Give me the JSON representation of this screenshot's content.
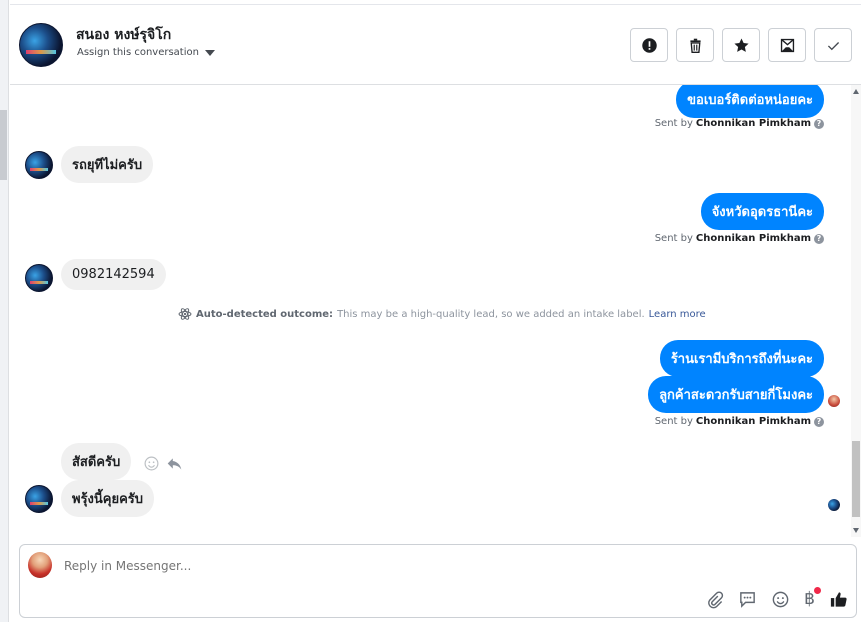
{
  "header": {
    "contact_name": "สนอง หงษ์รุจิโก",
    "assign_label": "Assign this conversation",
    "actions": [
      {
        "icon": "exclamation-icon",
        "label": "Mark as spam"
      },
      {
        "icon": "trash-icon",
        "label": "Delete"
      },
      {
        "icon": "star-icon",
        "label": "Star"
      },
      {
        "icon": "mail-icon",
        "label": "Mark as unread"
      },
      {
        "icon": "check-icon",
        "label": "Mark as done"
      }
    ]
  },
  "messages": [
    {
      "side": "out",
      "text": "ขอเบอร์ติดต่อหน่อยคะ"
    },
    {
      "side": "meta",
      "sent_by_prefix": "Sent by",
      "sent_by_name": "Chonnikan Pimkham"
    },
    {
      "side": "in",
      "text": "รถยุทีไม่ครับ"
    },
    {
      "side": "out",
      "text": "จังหวัดอุดรธานีคะ"
    },
    {
      "side": "meta",
      "sent_by_prefix": "Sent by",
      "sent_by_name": "Chonnikan Pimkham"
    },
    {
      "side": "in",
      "text": "0982142594"
    },
    {
      "side": "out",
      "text": "ร้านเรามีบริการถึงที่นะคะ"
    },
    {
      "side": "out",
      "text": "ลูกค้าสะดวกรับสายกี่โมงคะ"
    },
    {
      "side": "meta",
      "sent_by_prefix": "Sent by",
      "sent_by_name": "Chonnikan Pimkham"
    },
    {
      "side": "in",
      "text": "สัสดีครับ"
    },
    {
      "side": "in",
      "text": "พรุ้งนี้คุยครับ"
    }
  ],
  "auto_detect": {
    "title": "Auto-detected outcome:",
    "text": "This may be a high-quality lead, so we added an intake label.",
    "link": "Learn more"
  },
  "composer": {
    "placeholder": "Reply in Messenger...",
    "tools": [
      "paperclip-icon",
      "saved-reply-icon",
      "emoji-icon",
      "baht-icon",
      "thumbs-up-icon"
    ],
    "baht_symbol": "฿"
  },
  "colors": {
    "outgoing_bubble": "#0084ff",
    "incoming_bubble": "#f0f0f0",
    "notification_dot": "#f02849"
  }
}
